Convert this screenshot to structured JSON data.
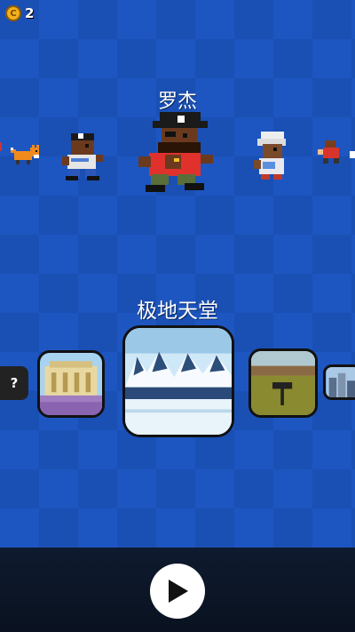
{
  "hud": {
    "coin_symbol": "C",
    "coin_count": "2"
  },
  "character": {
    "name": "罗杰"
  },
  "level": {
    "name": "极地天堂"
  },
  "locked_level": {
    "label": "?"
  },
  "controls": {
    "play_icon": "play-icon"
  }
}
